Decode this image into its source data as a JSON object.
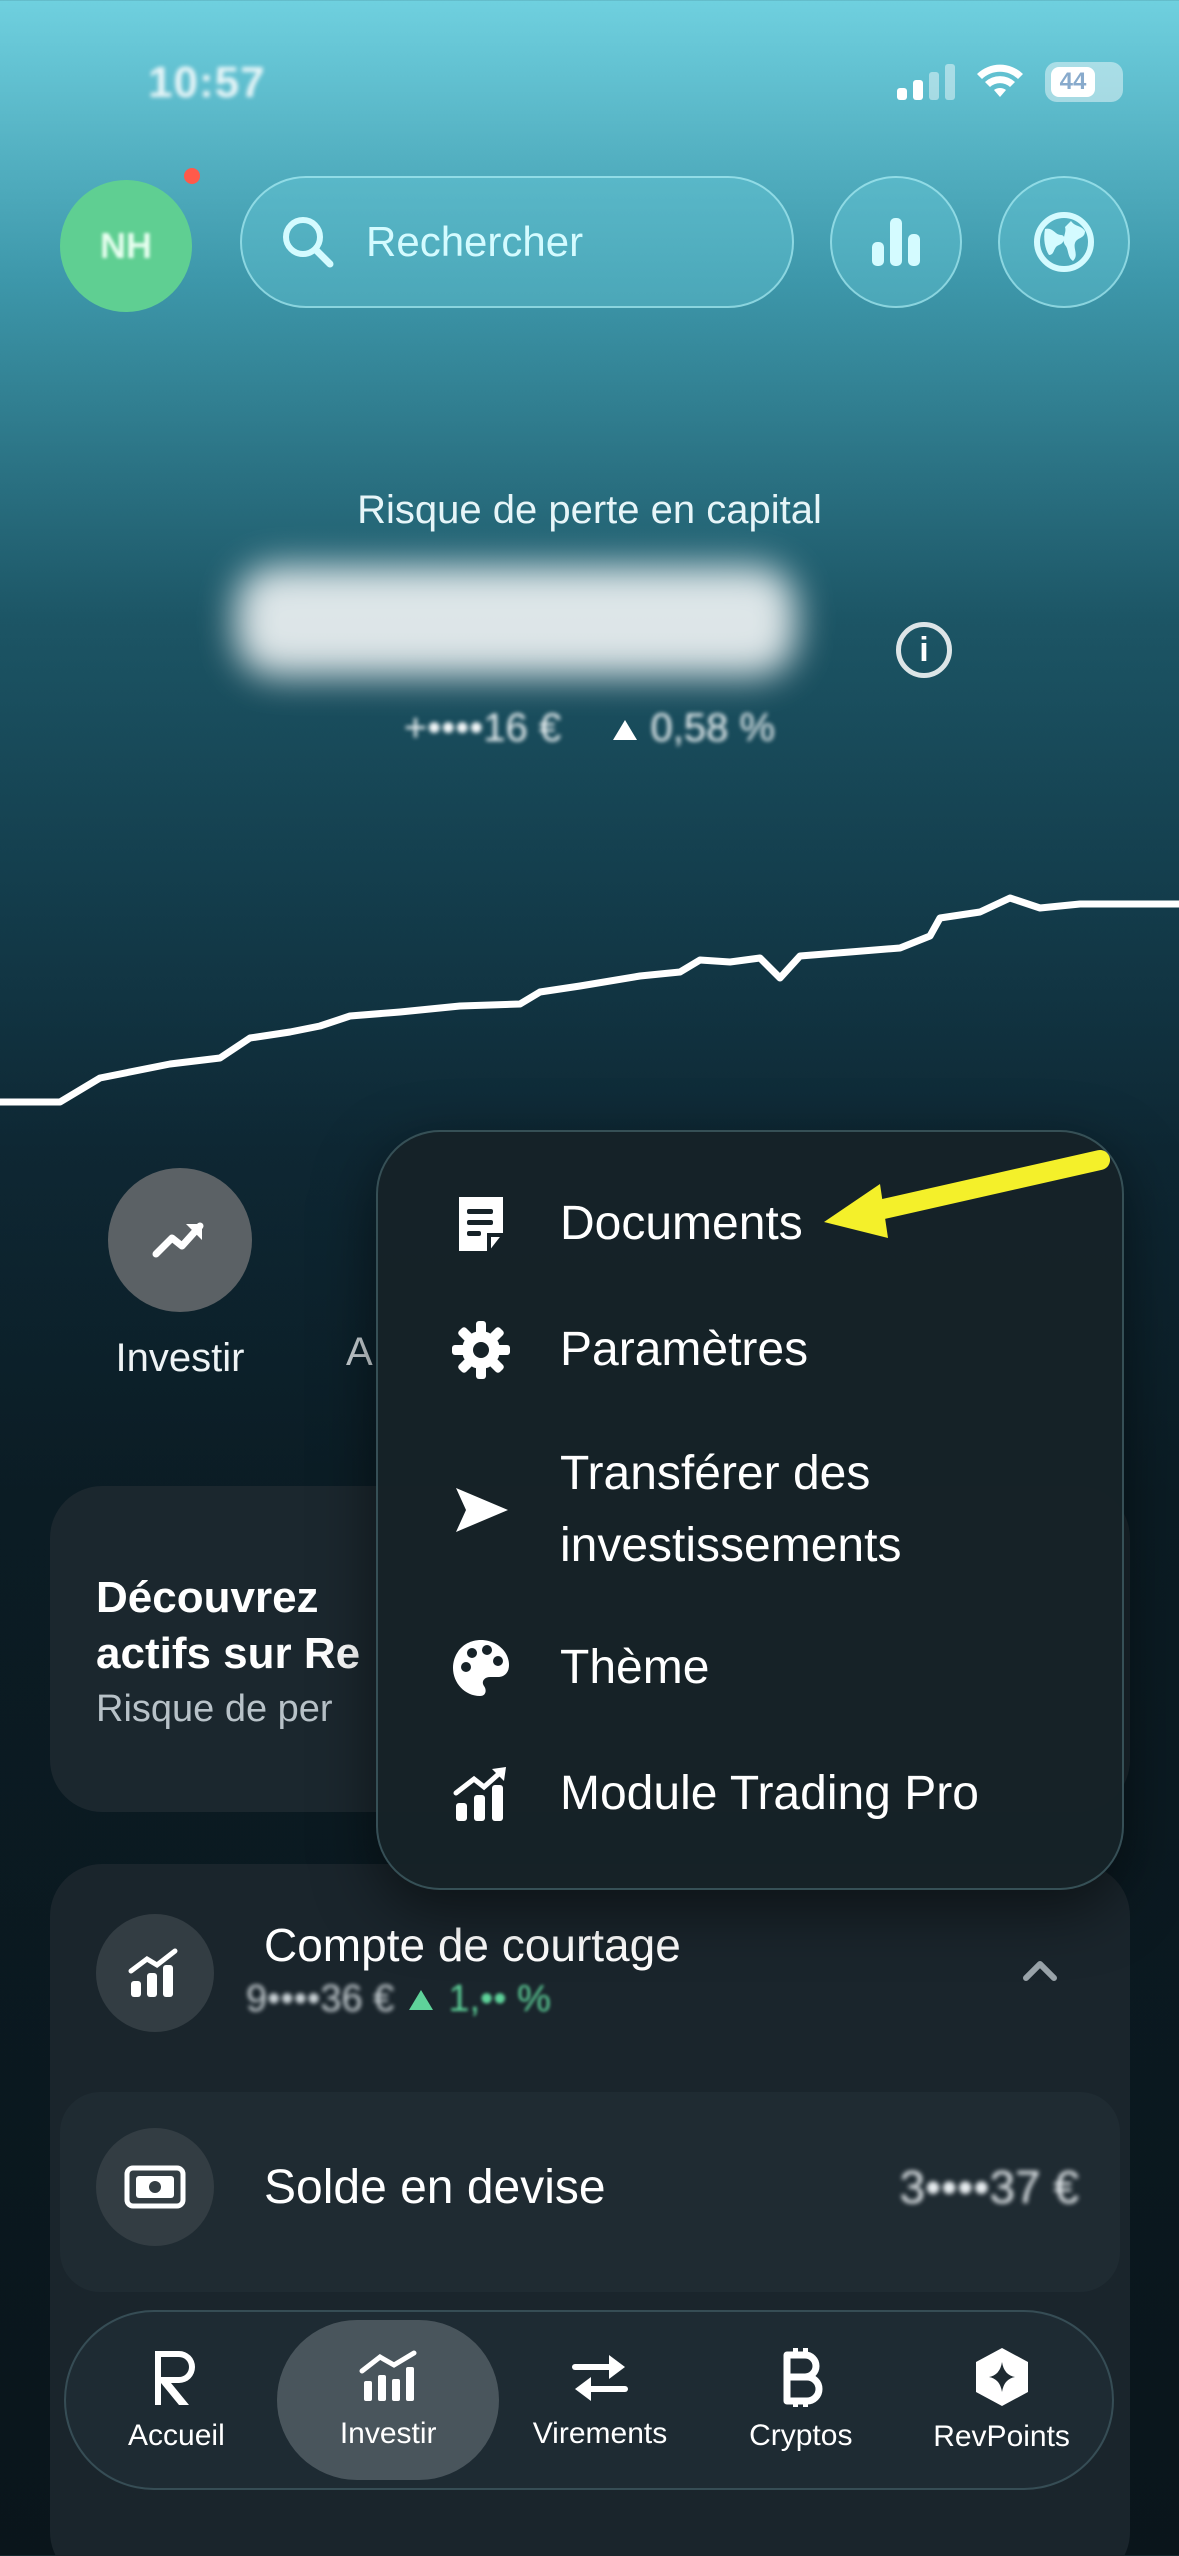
{
  "status_bar": {
    "time": "10:57",
    "battery": "44"
  },
  "top_bar": {
    "avatar_initials": "NH",
    "search_placeholder": "Rechercher",
    "analytics_icon": "bar-chart-icon",
    "globe_icon": "globe-icon"
  },
  "portfolio": {
    "risk_label": "Risque de perte en capital",
    "change_amount": "+••••16 €",
    "change_percent": "0,58 %"
  },
  "actions": {
    "invest_label": "Investir",
    "partial_label": "A"
  },
  "promo": {
    "title": "Découvrez\nactifs sur Re",
    "subtitle": "Risque de per"
  },
  "account": {
    "title": "Compte de courtage",
    "value": "9••••36 €",
    "change": "1,•• %"
  },
  "currency_balance": {
    "label": "Solde en devise",
    "amount": "3••••37 €"
  },
  "menu": {
    "items": [
      {
        "label": "Documents",
        "icon": "document-icon"
      },
      {
        "label": "Paramètres",
        "icon": "gear-icon"
      },
      {
        "label": "Transférer des investissements",
        "icon": "send-icon"
      },
      {
        "label": "Thème",
        "icon": "palette-icon"
      },
      {
        "label": "Module Trading Pro",
        "icon": "trading-chart-icon"
      }
    ]
  },
  "bottom_nav": {
    "items": [
      {
        "label": "Accueil",
        "icon": "revolut-r-icon"
      },
      {
        "label": "Investir",
        "icon": "invest-chart-icon",
        "active": true
      },
      {
        "label": "Virements",
        "icon": "transfer-arrows-icon"
      },
      {
        "label": "Cryptos",
        "icon": "bitcoin-icon"
      },
      {
        "label": "RevPoints",
        "icon": "revpoints-icon"
      }
    ]
  },
  "colors": {
    "accent_green": "#5fd39a",
    "annotation_yellow": "#f4f02a"
  }
}
